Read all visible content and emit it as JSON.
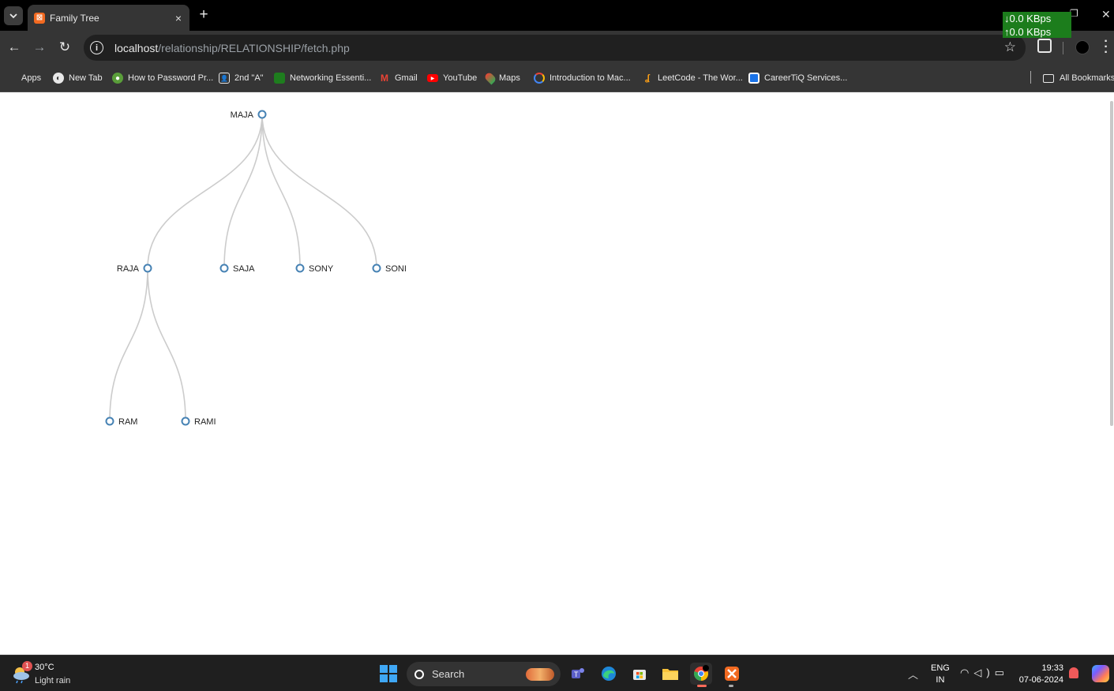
{
  "browser": {
    "tab_title": "Family Tree",
    "tab_close": "×",
    "new_tab": "+",
    "network_down": "↓0.0 KBps",
    "network_up": "↑0.0 KBps",
    "url_host": "localhost",
    "url_path": "/relationship/RELATIONSHIP/fetch.php"
  },
  "bookmarks": [
    {
      "label": "Apps",
      "icon": "apps-grid-icon",
      "color": "#e8453c"
    },
    {
      "label": "New Tab",
      "icon": "globe-icon",
      "color": "#e8e8e8"
    },
    {
      "label": "How to Password Pr...",
      "icon": "site-icon",
      "color": "#5a9e3a"
    },
    {
      "label": "2nd \"A\"",
      "icon": "contact-card-icon",
      "color": "#e8e8e8"
    },
    {
      "label": "Networking Essenti...",
      "icon": "cisco-icon",
      "color": "#1e7d1e"
    },
    {
      "label": "Gmail",
      "icon": "gmail-icon",
      "color": "#ea4335"
    },
    {
      "label": "YouTube",
      "icon": "youtube-icon",
      "color": "#ff0000"
    },
    {
      "label": "Maps",
      "icon": "maps-pin-icon",
      "color": "#34a853"
    },
    {
      "label": "Introduction to Mac...",
      "icon": "google-cloud-icon",
      "color": "#4285f4"
    },
    {
      "label": "LeetCode - The Wor...",
      "icon": "leetcode-icon",
      "color": "#ffa116"
    },
    {
      "label": "CareerTiQ Services...",
      "icon": "careertiq-icon",
      "color": "#1a73e8"
    }
  ],
  "all_bookmarks": "All Bookmarks",
  "tree": {
    "root": "MAJA",
    "children": [
      "RAJA",
      "SAJA",
      "SONY",
      "SONI"
    ],
    "grandchildren_of_raja": [
      "RAM",
      "RAMI"
    ]
  },
  "taskbar": {
    "weather_badge": "1",
    "temperature": "30°C",
    "condition": "Light rain",
    "search_label": "Search",
    "lang_top": "ENG",
    "lang_bottom": "IN",
    "time": "19:33",
    "date": "07-06-2024"
  }
}
